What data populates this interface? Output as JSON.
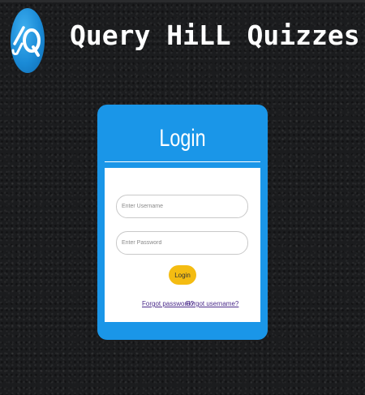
{
  "header": {
    "app_title": "Query HiLL Quizzes",
    "logo_icon": "qh-logo-icon"
  },
  "login_card": {
    "title": "Login",
    "username_placeholder": "Enter Username",
    "username_value": "",
    "password_placeholder": "Enter Password",
    "password_value": "",
    "login_label": "Login",
    "forgot_password_label": "Forgot password?",
    "forgot_username_label": "Forgot username?"
  },
  "colors": {
    "background": "#1b1c1e",
    "card_blue": "#1a96e8",
    "button_yellow": "#f4bc12",
    "link_purple": "#4a2a8a"
  }
}
